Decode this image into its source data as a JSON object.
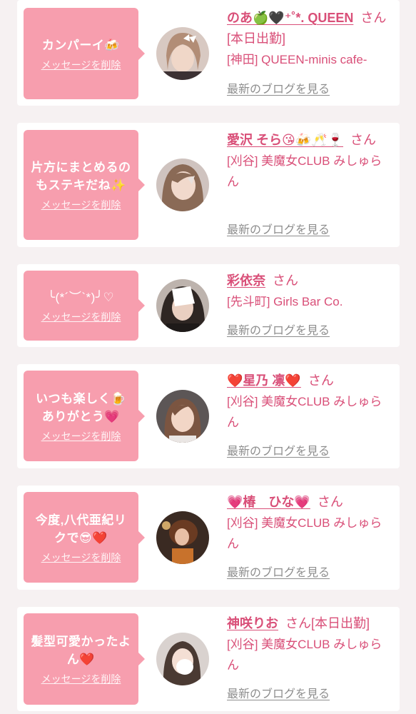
{
  "common": {
    "delete_label": "メッセージを削除",
    "blog_label": "最新のブログを見る",
    "suffix": "さん"
  },
  "messages": [
    {
      "text": "カンパーイ🍻",
      "name": "のあ🍏🖤⁺˚*. QUEEN",
      "status": "[本日出勤]",
      "shop": "[神田] QUEEN-minis cafe-"
    },
    {
      "text": "片方にまとめるのもステキだね✨",
      "name": "愛沢 そら😘🍻🥂🍷",
      "status": "",
      "shop": "[刈谷] 美魔女CLUB みしゅらん"
    },
    {
      "text": "╰(*´︶`*)╯♡",
      "name": "彩依奈",
      "status": "",
      "shop": "[先斗町] Girls Bar Co."
    },
    {
      "text": "いつも楽しく🍺ありがとう💗",
      "name": "❤️星乃 凛❤️",
      "status": "",
      "shop": "[刈谷] 美魔女CLUB みしゅらん"
    },
    {
      "text": "今度,八代亜紀リクで😎❤️",
      "name": "💗椿　ひな💗",
      "status": "",
      "shop": "[刈谷] 美魔女CLUB みしゅらん"
    },
    {
      "text": "髪型可愛かったよん❤️",
      "name": "神咲りお",
      "status": "[本日出勤]",
      "shop": "[刈谷] 美魔女CLUB みしゅらん"
    }
  ],
  "colors": {
    "accent_pink": "#f79eae",
    "name_pink": "#d94f78",
    "link_gray": "#8e8e8e",
    "page_bg": "#f6f1f2"
  },
  "icons": {
    "avatar": "profile-photo-icon"
  }
}
